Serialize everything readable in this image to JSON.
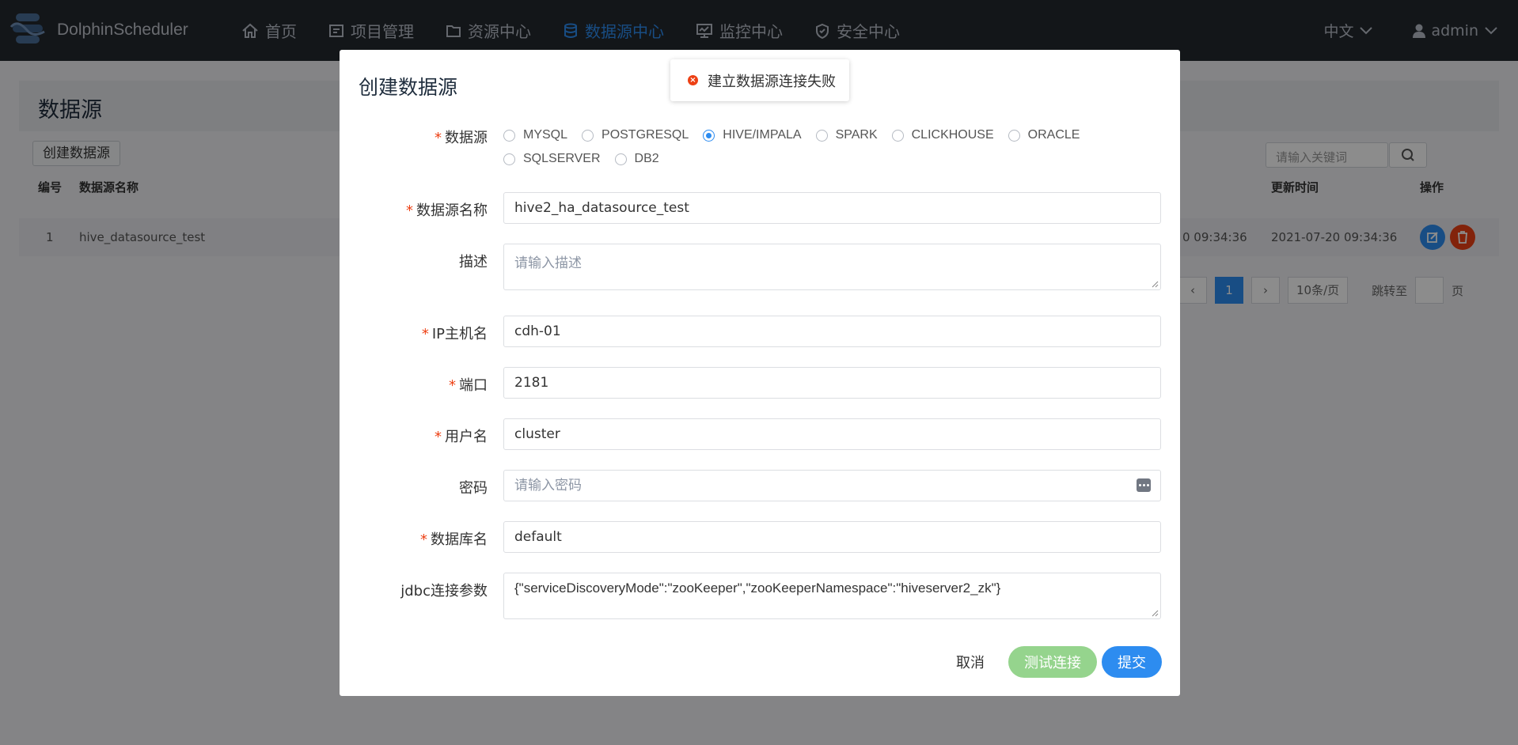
{
  "header": {
    "app_name": "DolphinScheduler",
    "nav": [
      "首页",
      "项目管理",
      "资源中心",
      "数据源中心",
      "监控中心",
      "安全中心"
    ],
    "language": "中文",
    "user": "admin"
  },
  "page": {
    "title": "数据源",
    "create_button": "创建数据源",
    "search_placeholder": "请输入关键词",
    "columns": [
      "编号",
      "数据源名称",
      "更新时间",
      "操作"
    ],
    "row": {
      "index": "1",
      "name": "hive_datasource_test",
      "create_time_partial": "0 09:34:36",
      "update_time": "2021-07-20 09:34:36"
    },
    "pager": {
      "current": "1",
      "page_size": "10条/页",
      "jump_label": "跳转至",
      "page_suffix": "页"
    }
  },
  "toast": {
    "message": "建立数据源连接失败"
  },
  "modal": {
    "title": "创建数据源",
    "fields": {
      "datasource_label": "数据源",
      "types": [
        "MYSQL",
        "POSTGRESQL",
        "HIVE/IMPALA",
        "SPARK",
        "CLICKHOUSE",
        "ORACLE",
        "SQLSERVER",
        "DB2"
      ],
      "selected_type": "HIVE/IMPALA",
      "name_label": "数据源名称",
      "name_value": "hive2_ha_datasource_test",
      "desc_label": "描述",
      "desc_placeholder": "请输入描述",
      "host_label": "IP主机名",
      "host_value": "cdh-01",
      "port_label": "端口",
      "port_value": "2181",
      "user_label": "用户名",
      "user_value": "cluster",
      "password_label": "密码",
      "password_placeholder": "请输入密码",
      "db_label": "数据库名",
      "db_value": "default",
      "jdbc_label": "jdbc连接参数",
      "jdbc_value": "{\"serviceDiscoveryMode\":\"zooKeeper\",\"zooKeeperNamespace\":\"hiveserver2_zk\"}"
    },
    "buttons": {
      "cancel": "取消",
      "test": "测试连接",
      "submit": "提交"
    }
  },
  "colors": {
    "primary": "#2d8cf0",
    "success_light": "#95d48d",
    "danger": "#ed4014",
    "header_bg": "#24292f"
  }
}
